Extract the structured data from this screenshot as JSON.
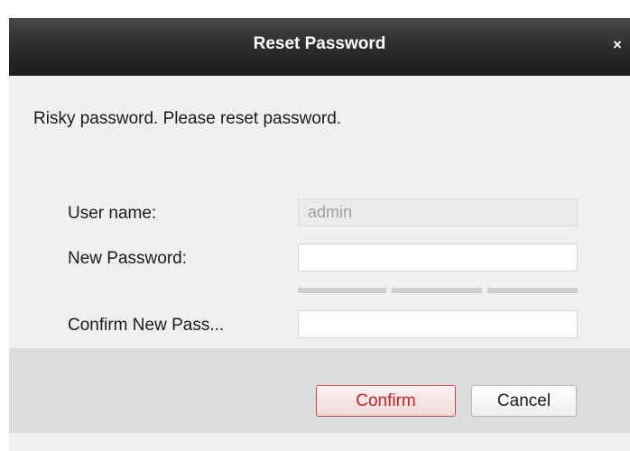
{
  "dialog": {
    "title": "Reset Password",
    "close_glyph": "×",
    "message": "Risky password. Please reset password."
  },
  "form": {
    "username_label": "User name:",
    "username_value": "admin",
    "new_password_label": "New Password:",
    "new_password_value": "",
    "confirm_password_label": "Confirm New Pass...",
    "confirm_password_value": ""
  },
  "buttons": {
    "confirm_label": "Confirm",
    "cancel_label": "Cancel"
  },
  "colors": {
    "titlebar": "#2e2e2e",
    "confirm_accent": "#cc1f1f"
  }
}
